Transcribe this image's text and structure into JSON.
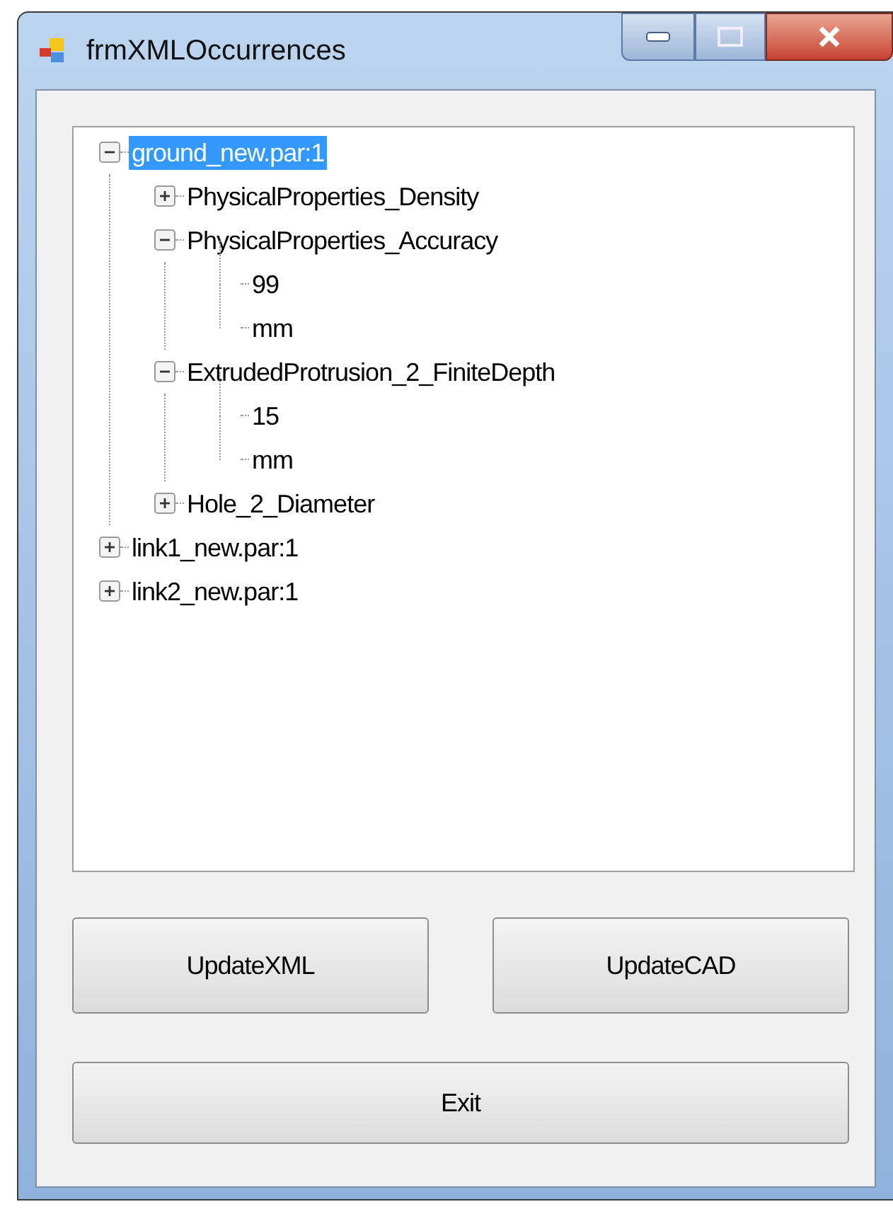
{
  "window": {
    "title": "frmXMLOccurrences"
  },
  "tree": [
    {
      "label": "ground_new.par:1",
      "selected": true,
      "expanded": true,
      "children": [
        {
          "label": "PhysicalProperties_Density",
          "selected": false,
          "expanded": false
        },
        {
          "label": "PhysicalProperties_Accuracy",
          "selected": false,
          "expanded": true,
          "children": [
            {
              "label": "99",
              "selected": false
            },
            {
              "label": "mm",
              "selected": false
            }
          ]
        },
        {
          "label": "ExtrudedProtrusion_2_FiniteDepth",
          "selected": false,
          "expanded": true,
          "children": [
            {
              "label": "15",
              "selected": false
            },
            {
              "label": "mm",
              "selected": false
            }
          ]
        },
        {
          "label": "Hole_2_Diameter",
          "selected": false,
          "expanded": false
        }
      ]
    },
    {
      "label": "link1_new.par:1",
      "selected": false,
      "expanded": false
    },
    {
      "label": "link2_new.par:1",
      "selected": false,
      "expanded": false
    }
  ],
  "buttons": [
    "UpdateXML",
    "UpdateCAD",
    "Exit"
  ]
}
